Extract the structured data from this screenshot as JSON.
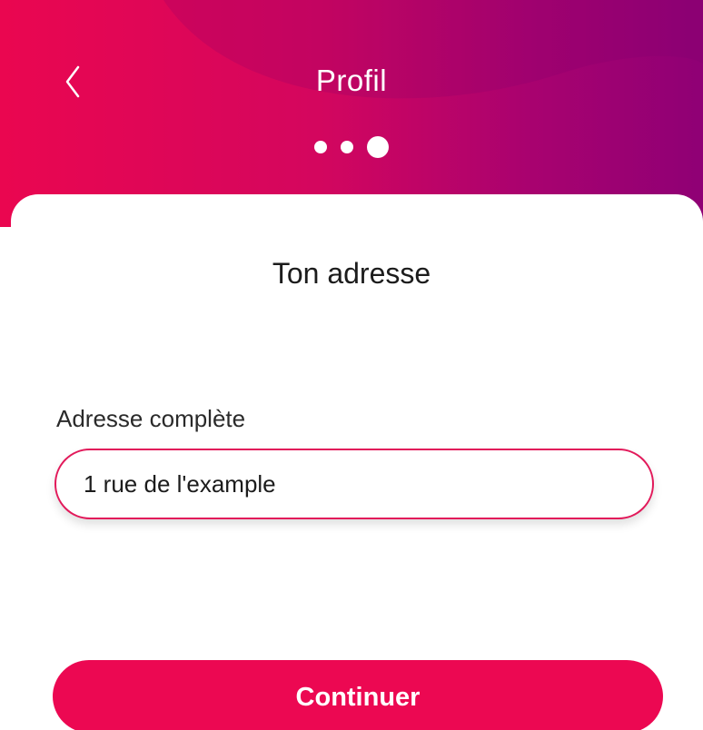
{
  "header": {
    "title": "Profil",
    "back_icon": "chevron-left-icon",
    "steps": {
      "total": 3,
      "current": 3
    },
    "gradient_colors": [
      "#ea0650",
      "#8f0075"
    ]
  },
  "main": {
    "section_title": "Ton adresse",
    "address_field": {
      "label": "Adresse complète",
      "value": "1 rue de l'example"
    },
    "continue_label": "Continuer"
  },
  "colors": {
    "accent": "#ec0852",
    "input_border": "#e2195a"
  }
}
